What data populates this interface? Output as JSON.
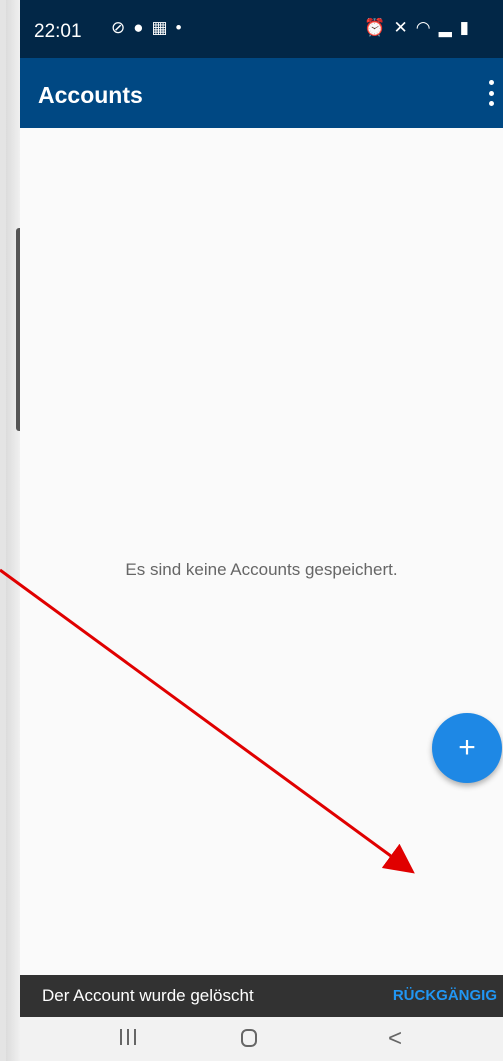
{
  "status_bar": {
    "time": "22:01",
    "left_icons": [
      "check-circle-icon",
      "alert-icon",
      "sim-icon",
      "dot-icon"
    ],
    "right_icons": [
      "alarm-icon",
      "mute-icon",
      "wifi-icon",
      "signal-icon",
      "battery-icon"
    ]
  },
  "app_bar": {
    "title": "Accounts",
    "menu_icon": "overflow-menu-icon"
  },
  "main": {
    "empty_message": "Es sind keine Accounts gespeichert."
  },
  "fab": {
    "icon": "plus-icon",
    "label": "+",
    "color": "#1e88e5"
  },
  "snackbar": {
    "message": "Der Account wurde gelöscht",
    "action": "RÜCKGÄNGIG"
  },
  "nav_bar": {
    "recent_icon": "recent-apps-icon",
    "home_icon": "home-icon",
    "back_icon": "back-icon",
    "back_glyph": "<"
  },
  "colors": {
    "status_bar": "#022747",
    "app_bar": "#004883",
    "snackbar": "#323232",
    "accent": "#2196f3",
    "annotation_arrow": "#e00000"
  }
}
